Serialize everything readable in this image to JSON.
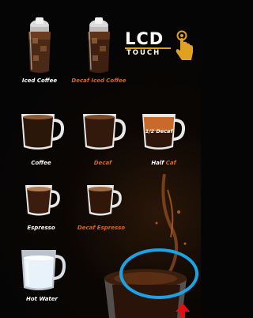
{
  "logo": {
    "line1": "LCD",
    "line2": "TOUCH"
  },
  "menu": {
    "iced_coffee": {
      "label": "Iced Coffee"
    },
    "decaf_iced_coffee": {
      "label": "Decaf Iced Coffee"
    },
    "coffee": {
      "label": "Coffee"
    },
    "decaf": {
      "label": "Decaf"
    },
    "half_caf": {
      "label_part1": "Half ",
      "label_part2": "Caf",
      "badge": "1/2 Decaf"
    },
    "espresso": {
      "label": "Espresso"
    },
    "decaf_espresso": {
      "label": "Decaf Espresso"
    },
    "hot_water": {
      "label": "Hot Water"
    }
  },
  "colors": {
    "accent": "#e0641a",
    "highlight_ring": "#1aa3e6",
    "pointer": "#e01010",
    "logo_bar": "#e0a020"
  },
  "icons": {
    "logo_hand": "pointing-hand-icon",
    "cursor": "arrow-cursor-icon"
  }
}
